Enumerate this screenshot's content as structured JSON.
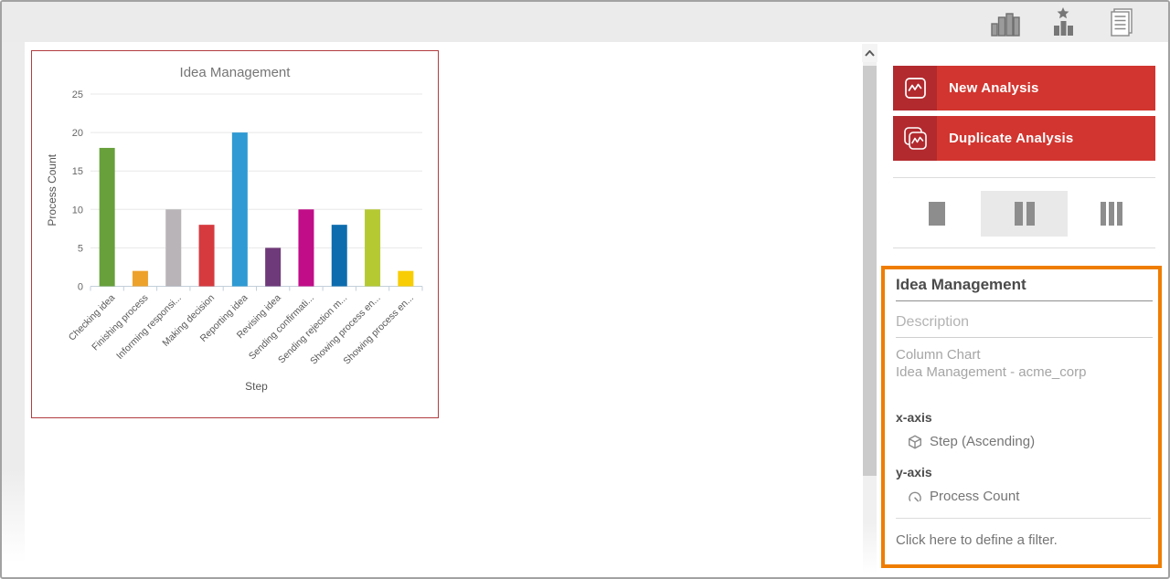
{
  "top_bar": {
    "icons": [
      {
        "name": "analyses-charts-icon"
      },
      {
        "name": "favorite-analysis-icon"
      },
      {
        "name": "reports-icon"
      }
    ]
  },
  "chart_data": {
    "type": "bar",
    "title": "Idea Management",
    "xlabel": "Step",
    "ylabel": "Process Count",
    "ylim": [
      0,
      25
    ],
    "yticks": [
      0,
      5,
      10,
      15,
      20,
      25
    ],
    "grid": true,
    "legend_position": "none",
    "categories": [
      "Checking idea",
      "Finishing process",
      "Informing responsi...",
      "Making decision",
      "Reporting idea",
      "Revising idea",
      "Sending confirmati...",
      "Sending rejection m...",
      "Showing process en...",
      "Showing process en..."
    ],
    "values": [
      18,
      2,
      10,
      8,
      20,
      5,
      10,
      8,
      10,
      2
    ],
    "bar_colors": [
      "#68a03c",
      "#eda22b",
      "#b8b4b8",
      "#d63a3f",
      "#2f9ad4",
      "#6f3a79",
      "#c10d88",
      "#0d6cae",
      "#b5c933",
      "#f8cd03"
    ]
  },
  "sidebar": {
    "new_analysis_label": "New Analysis",
    "duplicate_analysis_label": "Duplicate Analysis",
    "layout_toggles": {
      "options": [
        "one-column",
        "two-column",
        "three-column"
      ],
      "selected": "two-column"
    },
    "panel": {
      "title": "Idea Management",
      "description_placeholder": "Description",
      "chart_type": "Column Chart",
      "source": "Idea Management - acme_corp",
      "x_axis_label": "x-axis",
      "x_axis_value": "Step (Ascending)",
      "y_axis_label": "y-axis",
      "y_axis_value": "Process Count",
      "filter_text": "Click here to define a filter."
    }
  },
  "colors": {
    "accent_red": "#d2352f",
    "accent_red_dark": "#b22a2e",
    "accent_orange": "#ef7d00",
    "chart_card_border": "#b23c40",
    "selected_toggle_bg": "#e9e9e9"
  }
}
